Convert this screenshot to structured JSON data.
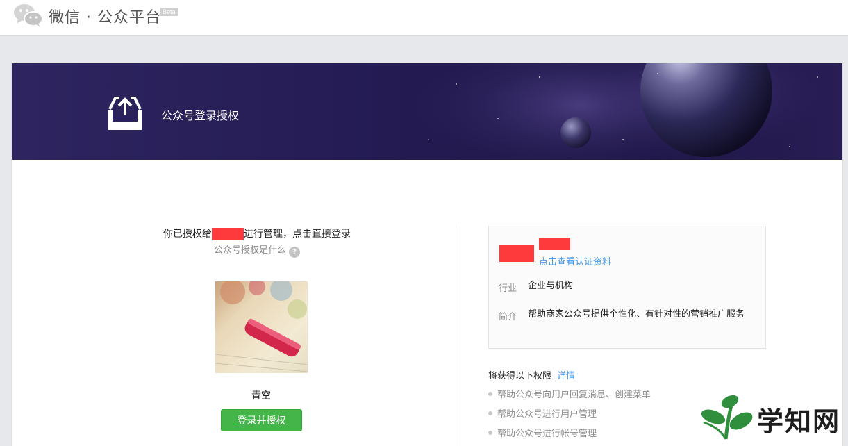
{
  "header": {
    "brand": "微信 · 公众平台",
    "beta": "Beta",
    "logo_icon": "wechat-logo-icon"
  },
  "banner": {
    "title": "公众号登录授权",
    "icon": "upload-tray-icon"
  },
  "auth": {
    "line_prefix": "你已授权给",
    "line_suffix": "进行管理，点击直接登录",
    "whatis": "公众号授权是什么",
    "help_glyph": "?",
    "account_name": "青空",
    "login_button": "登录并授权"
  },
  "info": {
    "verify_link": "点击查看认证资料",
    "industry_label": "行业",
    "industry_value": "企业与机构",
    "intro_label": "简介",
    "intro_value": "帮助商家公众号提供个性化、有针对性的营销推广服务"
  },
  "permissions": {
    "title": "将获得以下权限",
    "detail_link": "详情",
    "items": [
      "帮助公众号向用户回复消息、创建菜单",
      "帮助公众号进行用户管理",
      "帮助公众号进行帐号管理"
    ]
  },
  "watermark": {
    "text": "学知网"
  },
  "colors": {
    "accent_green": "#44b549",
    "link_blue": "#459ae9",
    "redaction": "#fe3a3d",
    "banner_bg": "#251c55"
  }
}
